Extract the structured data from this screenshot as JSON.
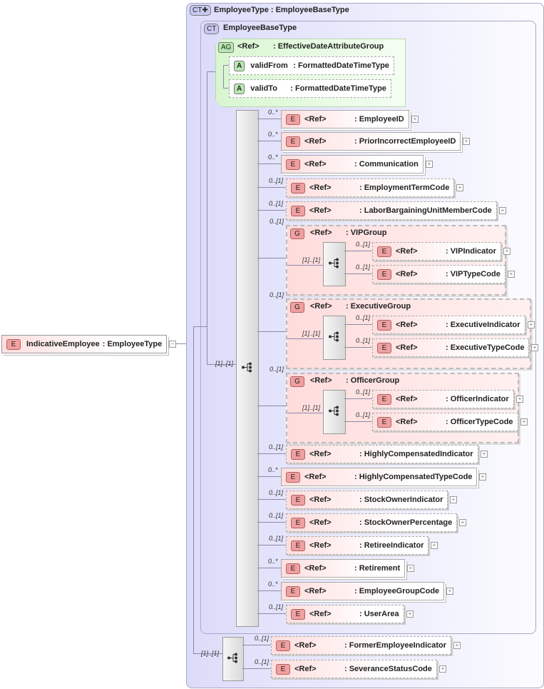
{
  "root": {
    "badge": "E",
    "name": "IndicativeEmployee",
    "type": ": EmployeeType",
    "toggle": "−"
  },
  "outer_ct": {
    "badge": "CT✚",
    "title": "EmployeeType : EmployeeBaseType"
  },
  "inner_ct": {
    "badge": "CT",
    "title": "EmployeeBaseType"
  },
  "attribute_group": {
    "badge": "AG",
    "ref": "<Ref>",
    "name": ": EffectiveDateAttributeGroup",
    "attributes": [
      {
        "badge": "A",
        "name": "validFrom",
        "type": ": FormattedDateTimeType"
      },
      {
        "badge": "A",
        "name": "validTo",
        "type": ": FormattedDateTimeType"
      }
    ]
  },
  "main_sequence": {
    "card": "[1]..[1]"
  },
  "children": [
    {
      "kind": "E",
      "card": "0..*",
      "ref": "<Ref>",
      "name": ": EmployeeID"
    },
    {
      "kind": "E",
      "card": "0..*",
      "ref": "<Ref>",
      "name": ": PriorIncorrectEmployeeID"
    },
    {
      "kind": "E",
      "card": "0..*",
      "ref": "<Ref>",
      "name": ": Communication"
    },
    {
      "kind": "E",
      "card": "0..[1]",
      "ref": "<Ref>",
      "name": ": EmploymentTermCode"
    },
    {
      "kind": "E",
      "card": "0..[1]",
      "ref": "<Ref>",
      "name": ": LaborBargainingUnitMemberCode"
    },
    {
      "kind": "G",
      "card": "0..[1]",
      "ref": "<Ref>",
      "name": ": VIPGroup",
      "seq_card": "[1]..[1]",
      "items": [
        {
          "card": "0..[1]",
          "ref": "<Ref>",
          "name": ": VIPIndicator"
        },
        {
          "card": "0..[1]",
          "ref": "<Ref>",
          "name": ": VIPTypeCode"
        }
      ]
    },
    {
      "kind": "G",
      "card": "0..[1]",
      "ref": "<Ref>",
      "name": ": ExecutiveGroup",
      "seq_card": "[1]..[1]",
      "items": [
        {
          "card": "0..[1]",
          "ref": "<Ref>",
          "name": ": ExecutiveIndicator"
        },
        {
          "card": "0..[1]",
          "ref": "<Ref>",
          "name": ": ExecutiveTypeCode"
        }
      ]
    },
    {
      "kind": "G",
      "card": "0..[1]",
      "ref": "<Ref>",
      "name": ": OfficerGroup",
      "seq_card": "[1]..[1]",
      "items": [
        {
          "card": "0..[1]",
          "ref": "<Ref>",
          "name": ": OfficerIndicator"
        },
        {
          "card": "0..[1]",
          "ref": "<Ref>",
          "name": ": OfficerTypeCode"
        }
      ]
    },
    {
      "kind": "E",
      "card": "0..[1]",
      "ref": "<Ref>",
      "name": ": HighlyCompensatedIndicator"
    },
    {
      "kind": "E",
      "card": "0..*",
      "ref": "<Ref>",
      "name": ": HighlyCompensatedTypeCode"
    },
    {
      "kind": "E",
      "card": "0..[1]",
      "ref": "<Ref>",
      "name": ": StockOwnerIndicator"
    },
    {
      "kind": "E",
      "card": "0..[1]",
      "ref": "<Ref>",
      "name": ": StockOwnerPercentage"
    },
    {
      "kind": "E",
      "card": "0..[1]",
      "ref": "<Ref>",
      "name": ": RetireeIndicator"
    },
    {
      "kind": "E",
      "card": "0..*",
      "ref": "<Ref>",
      "name": ": Retirement"
    },
    {
      "kind": "E",
      "card": "0..*",
      "ref": "<Ref>",
      "name": ": EmployeeGroupCode"
    },
    {
      "kind": "E",
      "card": "0..[1]",
      "ref": "<Ref>",
      "name": ": UserArea"
    }
  ],
  "bottom_sequence": {
    "card": "[1]..[1]",
    "items": [
      {
        "card": "0..[1]",
        "ref": "<Ref>",
        "name": ": FormerEmployeeIndicator"
      },
      {
        "card": "0..[1]",
        "ref": "<Ref>",
        "name": ": SeveranceStatusCode"
      }
    ]
  },
  "plus_symbol": "+",
  "colors": {
    "complex_type": "#dcdcfa",
    "element": "#f0a0a0",
    "attribute_group": "#d8f6d0"
  }
}
